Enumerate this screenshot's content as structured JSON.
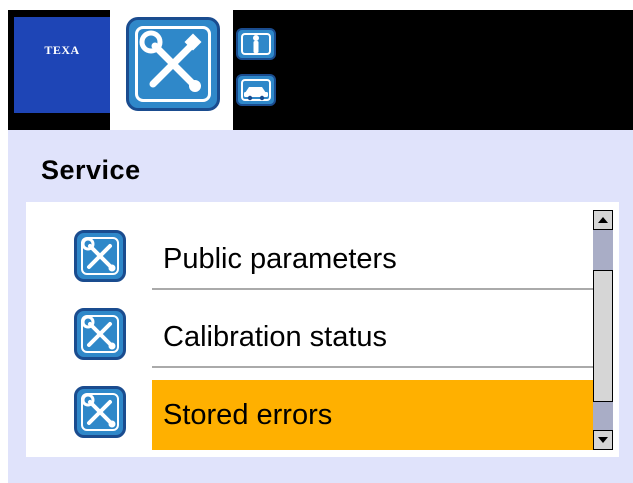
{
  "header": {
    "logo_text": "TEXA",
    "main_icon": "service-wrench-screwdriver-icon",
    "side_icons": [
      "person-icon",
      "car-icon"
    ]
  },
  "page": {
    "title": "Service"
  },
  "list": {
    "items": [
      {
        "label": "Public parameters",
        "icon": "wrench-screwdriver-icon",
        "selected": false
      },
      {
        "label": "Calibration status",
        "icon": "wrench-screwdriver-icon",
        "selected": false
      },
      {
        "label": "Stored errors",
        "icon": "wrench-screwdriver-icon",
        "selected": true
      }
    ]
  },
  "scrollbar": {
    "up_icon": "scroll-up-arrow-icon",
    "down_icon": "scroll-down-arrow-icon"
  },
  "colors": {
    "accent_blue": "#2f88c9",
    "brand_blue": "#1e45b6",
    "selection": "#ffb000",
    "background": "#e0e3fb"
  }
}
